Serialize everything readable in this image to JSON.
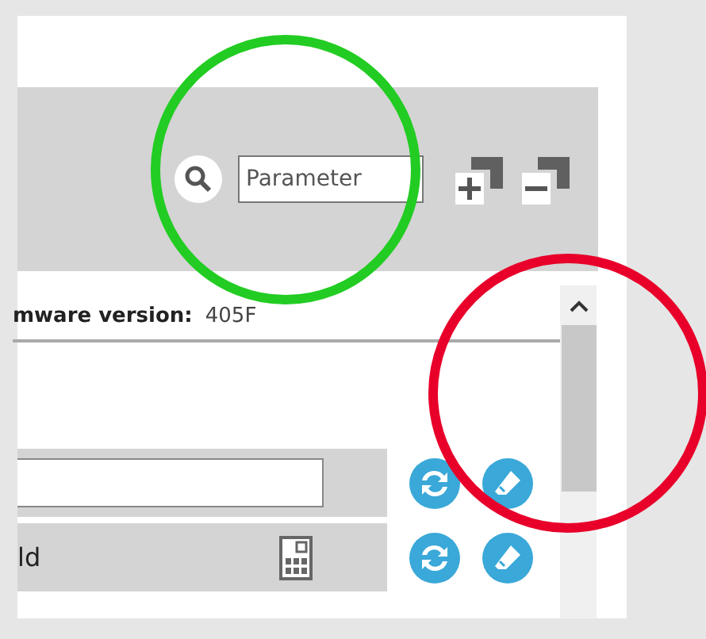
{
  "toolbar": {
    "search": {
      "placeholder": "Parameter"
    }
  },
  "info": {
    "label": "mware version:",
    "value": "405F"
  },
  "rows": [
    {
      "kind": "input",
      "text": ""
    },
    {
      "kind": "calc",
      "text": "ld"
    }
  ],
  "annotations": [
    {
      "color": "#22cc22"
    },
    {
      "color": "#e8002a"
    }
  ]
}
